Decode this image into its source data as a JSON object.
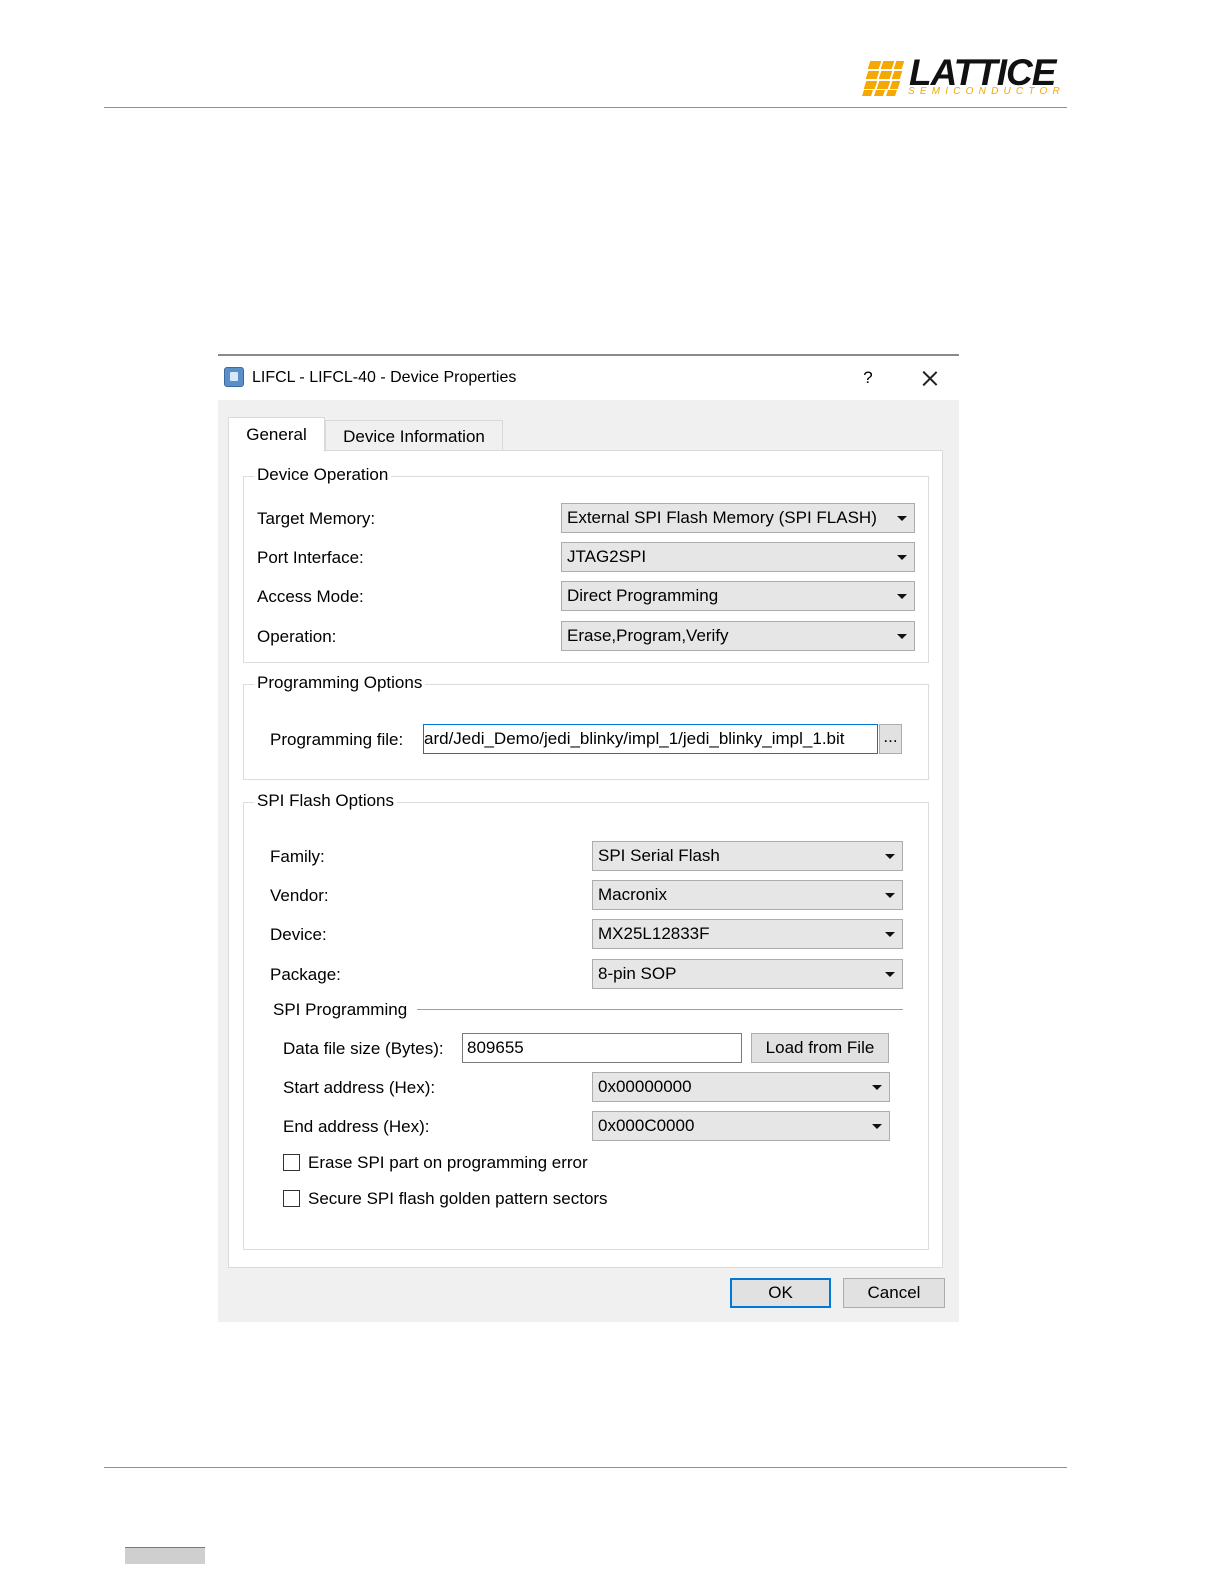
{
  "logo": {
    "word": "LATTICE",
    "sub": "SEMICONDUCTOR"
  },
  "dialog": {
    "title": "LIFCL - LIFCL-40 - Device Properties",
    "help_label": "?",
    "tabs": [
      {
        "label": "General",
        "active": true
      },
      {
        "label": "Device Information",
        "active": false
      }
    ],
    "device_operation": {
      "title": "Device Operation",
      "target_memory": {
        "label": "Target Memory:",
        "value": "External SPI Flash Memory (SPI FLASH)"
      },
      "port_interface": {
        "label": "Port Interface:",
        "value": "JTAG2SPI"
      },
      "access_mode": {
        "label": "Access Mode:",
        "value": "Direct Programming"
      },
      "operation": {
        "label": "Operation:",
        "value": "Erase,Program,Verify"
      }
    },
    "programming_options": {
      "title": "Programming Options",
      "file_label": "Programming file:",
      "file_value": "ard/Jedi_Demo/jedi_blinky/impl_1/jedi_blinky_impl_1.bit",
      "browse_label": "..."
    },
    "spi_flash_options": {
      "title": "SPI Flash Options",
      "family": {
        "label": "Family:",
        "value": "SPI Serial Flash"
      },
      "vendor": {
        "label": "Vendor:",
        "value": "Macronix"
      },
      "device": {
        "label": "Device:",
        "value": "MX25L12833F"
      },
      "package": {
        "label": "Package:",
        "value": "8-pin SOP"
      },
      "spi_programming": {
        "title": "SPI Programming",
        "data_file_size": {
          "label": "Data file size (Bytes):",
          "value": "809655"
        },
        "load_from_file_label": "Load from File",
        "start_address": {
          "label": "Start address (Hex):",
          "value": "0x00000000"
        },
        "end_address": {
          "label": "End address (Hex):",
          "value": "0x000C0000"
        },
        "erase_on_error": {
          "label": "Erase SPI part on programming error",
          "checked": false
        },
        "secure_golden": {
          "label": "Secure SPI flash golden pattern sectors",
          "checked": false
        }
      }
    },
    "ok_label": "OK",
    "cancel_label": "Cancel"
  },
  "colors": {
    "accent": "#0078d7",
    "logo_gold": "#f5a800"
  }
}
